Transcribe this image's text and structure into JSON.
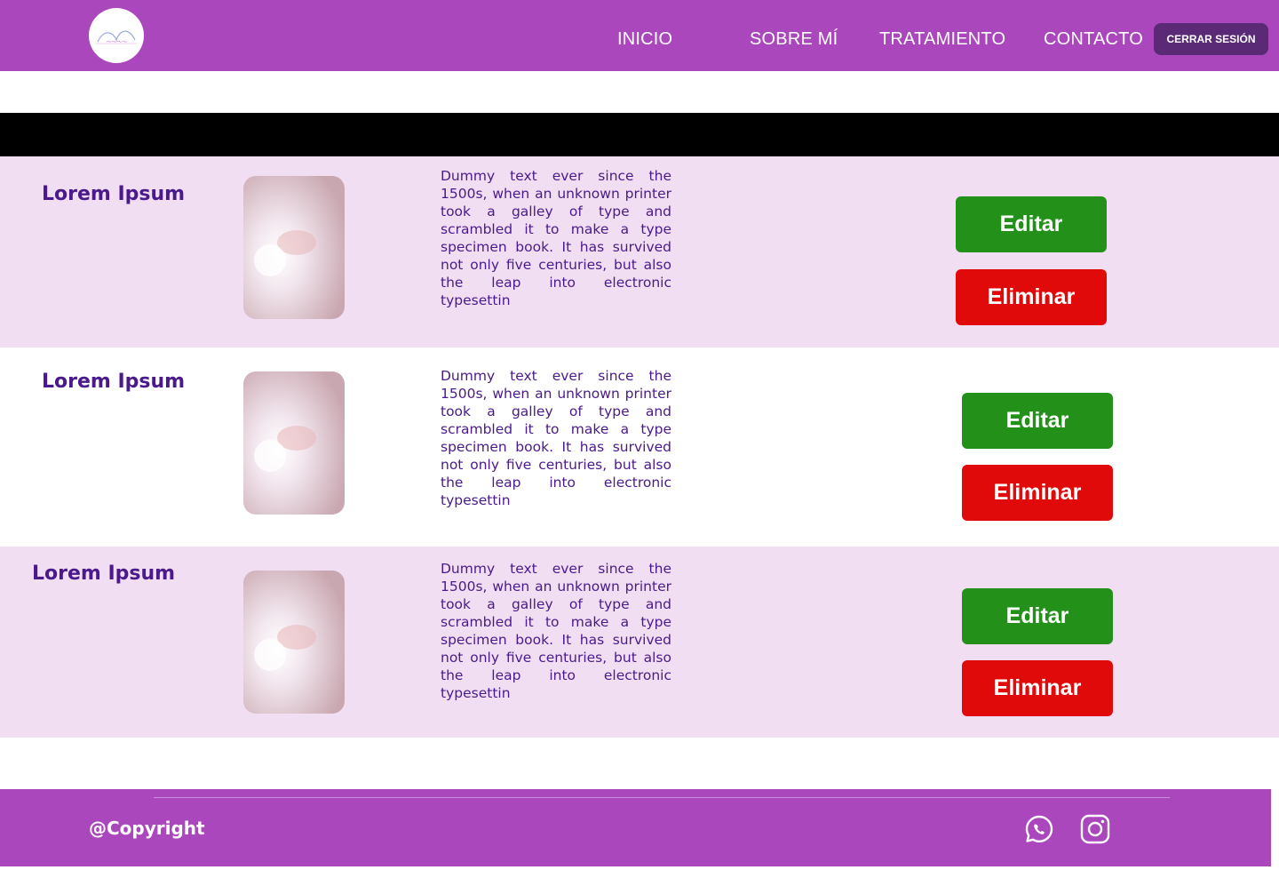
{
  "header": {
    "logo_icon": "butterfly-logo-icon",
    "nav": [
      {
        "label": "INICIO"
      },
      {
        "label": "SOBRE MÍ"
      },
      {
        "label": "TRATAMIENTO"
      },
      {
        "label": "CONTACTO"
      }
    ],
    "logout_label": "CERRAR SESIÓN"
  },
  "items": [
    {
      "title": "Lorem Ipsum",
      "description": "Dummy text ever since the 1500s, when an unknown printer took a galley of type and scrambled it to make a type specimen book. It has survived not only five centuries, but also the leap into electronic typesettin",
      "edit_label": "Editar",
      "delete_label": "Eliminar"
    },
    {
      "title": "Lorem Ipsum",
      "description": "  Dummy text ever since the 1500s, when an unknown printer took a galley of type and scrambled it to make a type specimen book. It has survived not only five centuries, but also the leap into electronic typesettin",
      "edit_label": "Editar",
      "delete_label": "Eliminar"
    },
    {
      "title": "Lorem Ipsum",
      "description": "  Dummy text ever since the 1500s, when an unknown printer took a galley of type and scrambled it to make a type specimen book. It has survived not only five centuries, but also the leap into electronic typesettin",
      "edit_label": "Editar",
      "delete_label": "Eliminar"
    }
  ],
  "footer": {
    "copyright": "@Copyright",
    "icons": [
      "whatsapp-icon",
      "instagram-icon"
    ]
  },
  "colors": {
    "brand_purple": "#ab47bc",
    "row_tint": "#f1def3",
    "edit_green": "#23901a",
    "delete_red": "#e00a0a",
    "text_purple": "#4a1a8c"
  }
}
